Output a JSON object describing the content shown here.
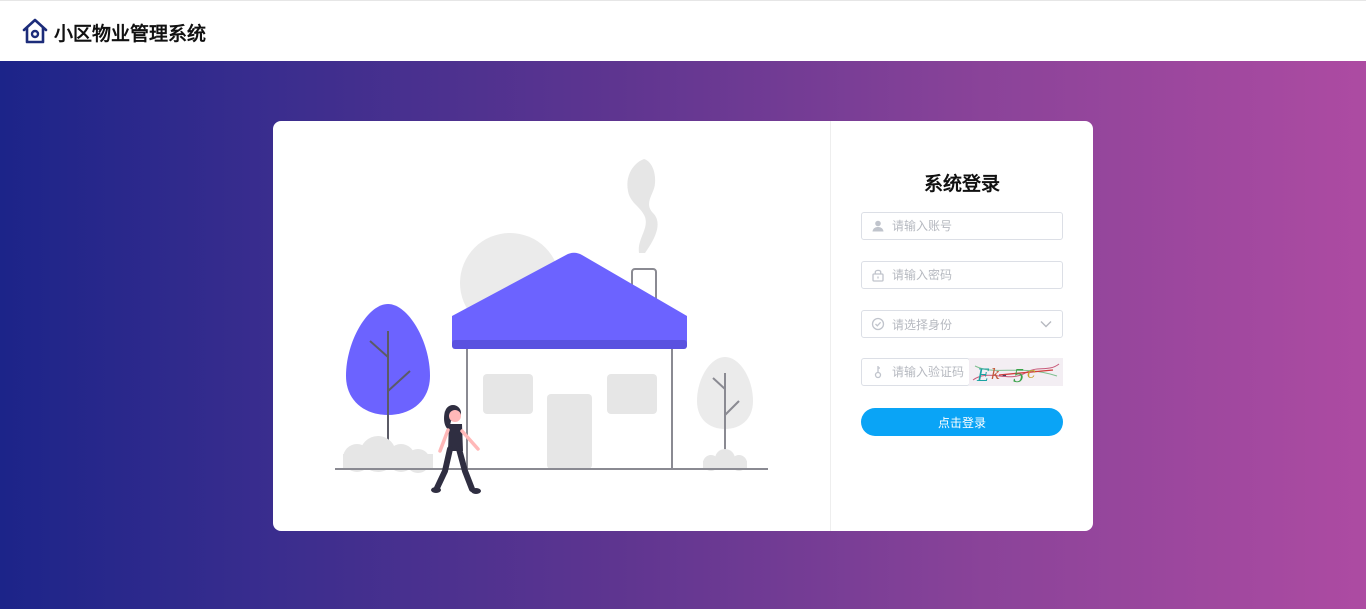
{
  "header": {
    "app_title": "小区物业管理系统",
    "logo_icon": "home-icon"
  },
  "login": {
    "title": "系统登录",
    "account": {
      "placeholder": "请输入账号",
      "value": "",
      "icon": "user-icon"
    },
    "password": {
      "placeholder": "请输入密码",
      "value": "",
      "icon": "lock-icon"
    },
    "role": {
      "placeholder": "请选择身份",
      "icon": "circle-check-icon"
    },
    "captcha": {
      "placeholder": "请输入验证码",
      "value": "",
      "icon": "key-icon",
      "image_text": "Ek-5c"
    },
    "submit_label": "点击登录"
  },
  "colors": {
    "accent": "#0aa4f6",
    "house": "#6c63ff",
    "gradient_start": "#1c2489",
    "gradient_end": "#ad4ba2"
  }
}
